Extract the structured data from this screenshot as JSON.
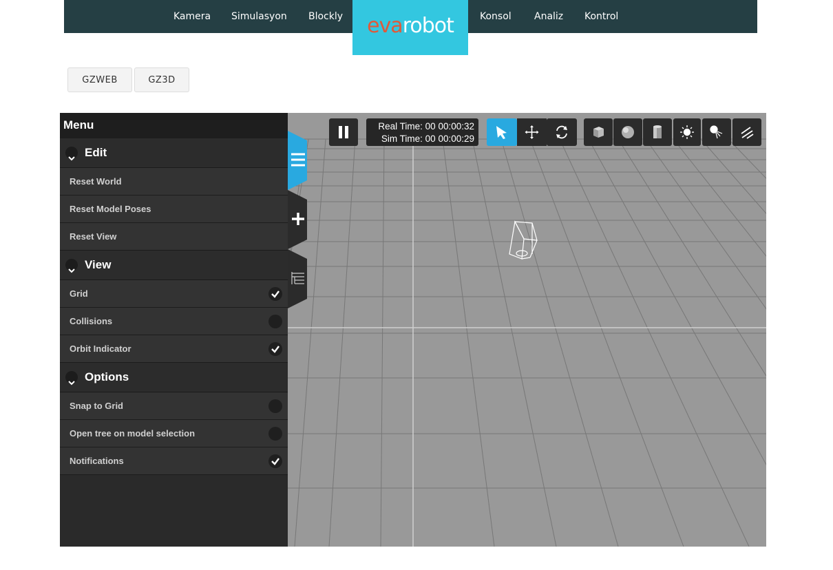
{
  "nav": {
    "links": [
      "Kamera",
      "Simulasyon",
      "Blockly",
      "Konsol",
      "Analiz",
      "Kontrol"
    ],
    "logo": {
      "part1": "eva",
      "part2": "robot"
    }
  },
  "buttons": {
    "gzweb": "GZWEB",
    "gz3d": "GZ3D"
  },
  "menu": {
    "title": "Menu",
    "sections": [
      {
        "label": "Edit",
        "items": [
          {
            "label": "Reset World"
          },
          {
            "label": "Reset Model Poses"
          },
          {
            "label": "Reset View"
          }
        ]
      },
      {
        "label": "View",
        "items": [
          {
            "label": "Grid",
            "checked": true
          },
          {
            "label": "Collisions",
            "checked": false
          },
          {
            "label": "Orbit Indicator",
            "checked": true
          }
        ]
      },
      {
        "label": "Options",
        "items": [
          {
            "label": "Snap to Grid",
            "checked": false
          },
          {
            "label": "Open tree on model selection",
            "checked": false
          },
          {
            "label": "Notifications",
            "checked": true
          }
        ]
      }
    ]
  },
  "toolbar": {
    "real_time": "Real Time: 00 00:00:32",
    "sim_time": "Sim Time: 00 00:00:29",
    "active_tool": "select",
    "icons": [
      "pause-icon",
      "select-arrow-icon",
      "translate-icon",
      "rotate-icon",
      "box-icon",
      "sphere-icon",
      "cylinder-icon",
      "point-light-icon",
      "spot-light-icon",
      "directional-light-icon"
    ]
  },
  "colors": {
    "nav_bg": "#253f44",
    "logo_bg": "#33c7e0",
    "accent": "#29a9e0",
    "scene_bg": "#999999",
    "menu_bg": "#2a2a2a"
  }
}
